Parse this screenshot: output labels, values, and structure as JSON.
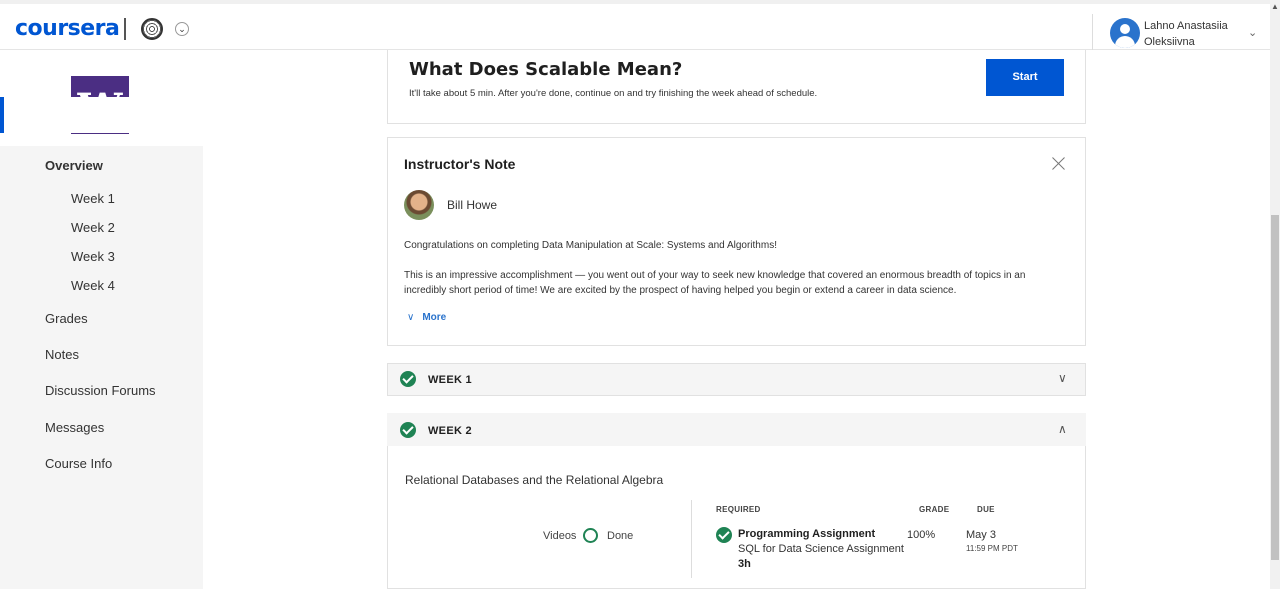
{
  "header": {
    "logo": "coursera",
    "user_name": "Lahno Anastasiia Oleksiivna"
  },
  "sidebar": {
    "items": [
      {
        "label": "Overview"
      },
      {
        "label": "Week 1"
      },
      {
        "label": "Week 2"
      },
      {
        "label": "Week 3"
      },
      {
        "label": "Week 4"
      },
      {
        "label": "Grades"
      },
      {
        "label": "Notes"
      },
      {
        "label": "Discussion Forums"
      },
      {
        "label": "Messages"
      },
      {
        "label": "Course Info"
      }
    ]
  },
  "next_item": {
    "title": "What Does Scalable Mean?",
    "subtitle": "It'll take about 5 min. After you're done, continue on and try finishing the week ahead of schedule.",
    "button": "Start"
  },
  "instructor_note": {
    "heading": "Instructor's Note",
    "instructor": "Bill Howe",
    "paragraph1": "Congratulations on completing Data Manipulation at Scale: Systems and Algorithms!",
    "paragraph2": "This is an impressive accomplishment — you went out of your way to seek new knowledge that covered an enormous breadth of topics in an incredibly short period of time! We are excited by the prospect of having helped you begin or extend a career in data science.",
    "more": "More"
  },
  "weeks": [
    {
      "label": "WEEK 1"
    },
    {
      "label": "WEEK 2"
    }
  ],
  "week2": {
    "module_title": "Relational Databases and the Relational Algebra",
    "videos_label": "Videos",
    "done_label": "Done",
    "col_required": "REQUIRED",
    "col_grade": "GRADE",
    "col_due": "DUE",
    "assignment_type": "Programming Assignment",
    "assignment_name": "SQL for Data Science Assignment",
    "assignment_duration": "3h",
    "grade": "100%",
    "due_date": "May 3",
    "due_time": "11:59 PM PDT"
  },
  "colors": {
    "accent": "#0056d2",
    "success": "#1f8354",
    "uw_purple": "#4b2e83"
  }
}
